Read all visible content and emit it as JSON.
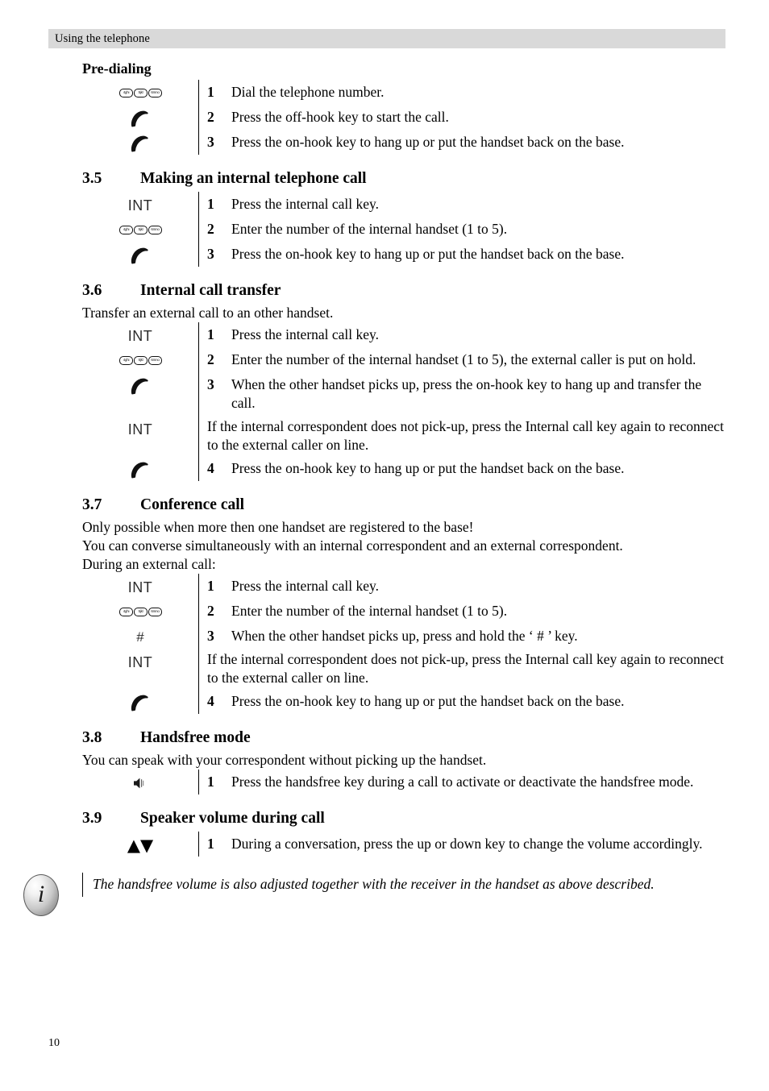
{
  "header": {
    "running_title": "Using the telephone"
  },
  "footer": {
    "page_number": "10"
  },
  "icons": {
    "keypad": {
      "name": "keypad-keys-icon",
      "keys": [
        "4ghi",
        "5jkl",
        "6mno"
      ]
    },
    "offhook": {
      "name": "off-hook-handset-icon"
    },
    "onhook": {
      "name": "on-hook-handset-icon"
    },
    "int": {
      "name": "internal-call-key-icon",
      "label": "INT"
    },
    "hash": {
      "name": "hash-key-icon",
      "label": "#"
    },
    "handsfree": {
      "name": "handsfree-speaker-icon"
    },
    "updown": {
      "name": "up-down-arrow-keys-icon",
      "label": "▲▼"
    },
    "info": {
      "name": "info-note-icon",
      "glyph": "i"
    }
  },
  "sections": [
    {
      "id": "pre-dialing",
      "number": "",
      "title": "Pre-dialing",
      "heading_style": "sub",
      "intro": [],
      "steps": [
        {
          "icon": "keypad",
          "num": "1",
          "text": "Dial the telephone number."
        },
        {
          "icon": "offhook",
          "num": "2",
          "text": "Press the off-hook key to start the call."
        },
        {
          "icon": "onhook",
          "num": "3",
          "text": "Press the on-hook key to hang up or put the handset back on the base."
        }
      ]
    },
    {
      "id": "making-an-internal-telephone-call",
      "number": "3.5",
      "title": "Making an internal telephone call",
      "heading_style": "sec",
      "intro": [],
      "steps": [
        {
          "icon": "int",
          "num": "1",
          "text": "Press the internal call key."
        },
        {
          "icon": "keypad",
          "num": "2",
          "text": "Enter the number of the internal handset (1 to 5)."
        },
        {
          "icon": "onhook",
          "num": "3",
          "text": "Press the on-hook key to hang up or put the handset back on the base."
        }
      ]
    },
    {
      "id": "internal-call-transfer",
      "number": "3.6",
      "title": "Internal call transfer",
      "heading_style": "sec",
      "intro": [
        "Transfer an external call to an other handset."
      ],
      "steps": [
        {
          "icon": "int",
          "num": "1",
          "text": "Press the internal call key."
        },
        {
          "icon": "keypad",
          "num": "2",
          "text": "Enter the number of the internal handset (1 to 5), the external caller is put on hold."
        },
        {
          "icon": "onhook",
          "num": "3",
          "text": "When the other handset picks up, press the on-hook key to hang up and transfer the call."
        },
        {
          "icon": "int",
          "num": "",
          "text": "If the internal correspondent does not pick-up, press the Internal call key again to reconnect to the external caller on line."
        },
        {
          "icon": "onhook",
          "num": "4",
          "text": "Press the on-hook key to hang up or put the handset back on the base."
        }
      ]
    },
    {
      "id": "conference-call",
      "number": "3.7",
      "title": "Conference call",
      "heading_style": "sec",
      "intro": [
        "Only possible when more then one handset are registered to the base!",
        "You can converse simultaneously with an internal correspondent and an external correspondent.",
        "During an external call:"
      ],
      "steps": [
        {
          "icon": "int",
          "num": "1",
          "text": "Press the internal call key."
        },
        {
          "icon": "keypad",
          "num": "2",
          "text": "Enter the number of the internal handset (1 to 5)."
        },
        {
          "icon": "hash",
          "num": "3",
          "text": "When the other handset picks up, press and hold the ‘ # ’ key."
        },
        {
          "icon": "int",
          "num": "",
          "text": "If the internal correspondent does not pick-up, press the Internal call key again to reconnect to the external caller on line."
        },
        {
          "icon": "onhook",
          "num": "4",
          "text": "Press the on-hook key to hang up or put the handset back on the base."
        }
      ]
    },
    {
      "id": "handsfree-mode",
      "number": "3.8",
      "title": "Handsfree mode",
      "heading_style": "sec",
      "intro": [
        "You can speak with your correspondent without picking up the handset."
      ],
      "steps": [
        {
          "icon": "handsfree",
          "num": "1",
          "text": "Press the handsfree key during a call to activate or deactivate the handsfree mode."
        }
      ]
    },
    {
      "id": "speaker-volume-during-call",
      "number": "3.9",
      "title": "Speaker volume during call",
      "heading_style": "sec",
      "intro": [],
      "steps": [
        {
          "icon": "updown",
          "num": "1",
          "text": "During a conversation, press the up or down key to change the volume accordingly."
        }
      ]
    }
  ],
  "note": {
    "text": "The handsfree volume is also adjusted together with the receiver in the handset as above described."
  }
}
